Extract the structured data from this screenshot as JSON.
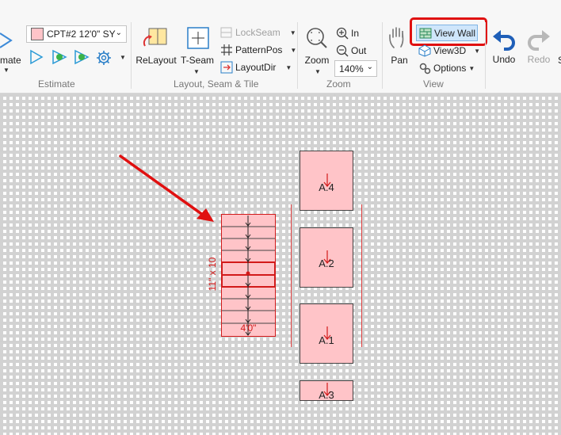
{
  "ribbon": {
    "estimate": {
      "group_label": "Estimate",
      "partial_label": "mate",
      "selector_value": "CPT#2 12'0\" SY",
      "swatch_color": "#ffc4c8"
    },
    "layout": {
      "group_label": "Layout, Seam & Tile",
      "relayout": "ReLayout",
      "tseam": "T-Seam",
      "lockseam": "LockSeam",
      "patternpos": "PatternPos",
      "layoutdir": "LayoutDir"
    },
    "zoom": {
      "group_label": "Zoom",
      "zoom": "Zoom",
      "in": "In",
      "out": "Out",
      "level": "140%"
    },
    "view": {
      "group_label": "View",
      "pan": "Pan",
      "view_wall": "View Wall",
      "view3d": "View3D",
      "options": "Options"
    },
    "undo": "Undo",
    "redo": "Redo",
    "highlight_color": "#e01010"
  },
  "canvas": {
    "pieces": [
      {
        "label": "A.4"
      },
      {
        "label": "A.2"
      },
      {
        "label": "A.1"
      },
      {
        "label": "A.3"
      }
    ],
    "tile_size_label": "11\" x 10",
    "tile_width_label": "4'0\"",
    "piece_fill": "#ffc4c8",
    "accent_red": "#d21a1a"
  }
}
